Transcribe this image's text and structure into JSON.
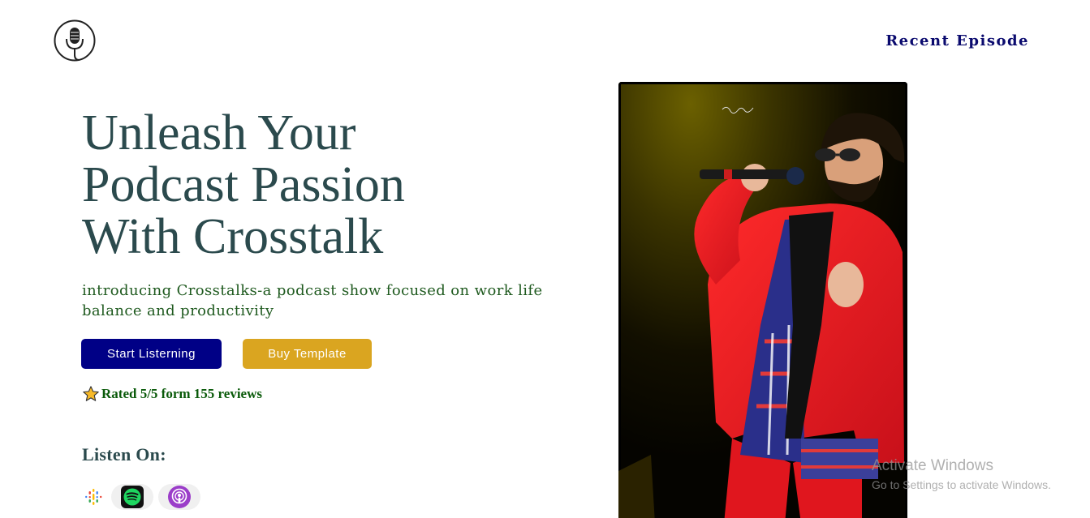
{
  "header": {
    "logo_icon": "microphone-icon",
    "nav_link": "Recent Episode"
  },
  "hero": {
    "title_lines": [
      "Unleash Your",
      "Podcast Passion",
      "With Crosstalk"
    ],
    "subtitle": "introducing Crosstalks-a podcast show focused on work life balance and productivity",
    "primary_button": "Start Listerning",
    "secondary_button": "Buy Template",
    "rating_icon": "star-icon",
    "rating_text": "Rated 5/5 form 155 reviews",
    "listen_heading": "Listen On:",
    "platforms": [
      {
        "name": "google-podcasts-icon"
      },
      {
        "name": "spotify-icon"
      },
      {
        "name": "apple-podcasts-icon"
      }
    ]
  },
  "colors": {
    "title": "#2b4a4d",
    "subtitle": "#1f5a1f",
    "nav": "#0a0a6e",
    "primary_button": "#000086",
    "secondary_button": "#daa520",
    "rating": "#0a5a0a"
  },
  "watermark": {
    "title": "Activate Windows",
    "subtitle": "Go to Settings to activate Windows."
  }
}
